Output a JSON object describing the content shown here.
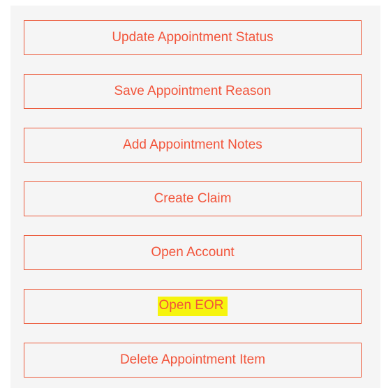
{
  "actions": {
    "update_status": "Update Appointment Status",
    "save_reason": "Save Appointment Reason",
    "add_notes": "Add Appointment Notes",
    "create_claim": "Create Claim",
    "open_account": "Open Account",
    "open_eor": "Open EOR",
    "delete_item": "Delete Appointment Item"
  },
  "colors": {
    "accent": "#f2543a",
    "border": "#ec5b3c",
    "panel_background": "#f5f5f5",
    "highlight": "#f6f40e"
  }
}
